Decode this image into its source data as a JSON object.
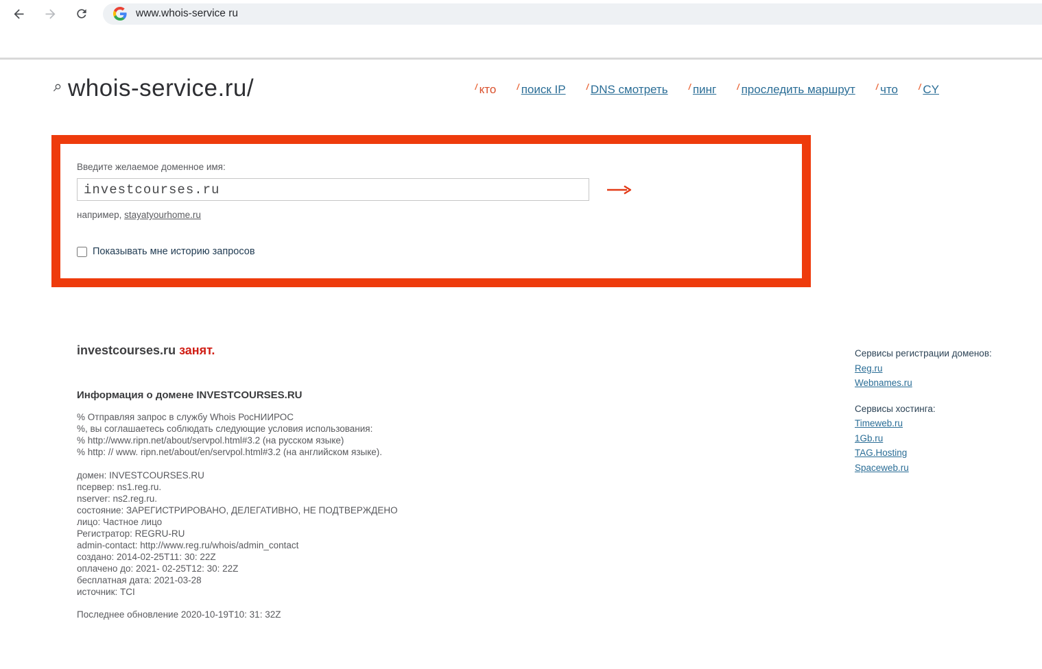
{
  "browser": {
    "url": "www.whois-service ru"
  },
  "header": {
    "title": "whois-service.ru/",
    "nav": [
      {
        "label": "кто",
        "active": true
      },
      {
        "label": "поиск IP",
        "active": false
      },
      {
        "label": "DNS смотреть",
        "active": false
      },
      {
        "label": "пинг",
        "active": false
      },
      {
        "label": "проследить маршрут",
        "active": false
      },
      {
        "label": "что",
        "active": false
      },
      {
        "label": "CY",
        "active": false
      }
    ]
  },
  "form": {
    "label": "Введите желаемое доменное имя:",
    "input_value": "investcourses.ru",
    "example_prefix": "например, ",
    "example_link": "stayatyourhome.ru",
    "checkbox_label": "Показывать мне историю запросов",
    "checkbox_checked": false
  },
  "result": {
    "domain": "investcourses.ru",
    "status": "занят.",
    "info_heading": "Информация о домене INVESTCOURSES.RU",
    "notice_lines": [
      "% Отправляя запрос в службу Whois РосНИИРОС",
      "%, вы соглашаетесь соблюдать следующие условия использования:",
      "% http://www.ripn.net/about/servpol.html#3.2 (на русском языке)",
      "% http: // www. ripn.net/about/en/servpol.html#3.2 (на английском языке)."
    ],
    "record_lines": [
      "домен: INVESTCOURSES.RU",
      "псервер: ns1.reg.ru.",
      "nserver: ns2.reg.ru.",
      "состояние: ЗАРЕГИСТРИРОВАНО, ДЕЛЕГАТИВНО, НЕ ПОДТВЕРЖДЕНО",
      "лицо: Частное лицо",
      "Регистратор: REGRU-RU",
      "admin-contact: http://www.reg.ru/whois/admin_contact",
      "создано: 2014-02-25T11: 30: 22Z",
      "оплачено до: 2021- 02-25T12: 30: 22Z",
      "бесплатная дата: 2021-03-28",
      "источник: TCI"
    ],
    "last_update": "Последнее обновление 2020-10-19T10: 31: 32Z"
  },
  "sidebar": {
    "registration_heading": "Сервисы регистрации доменов:",
    "registration_links": [
      "Reg.ru",
      "Webnames.ru"
    ],
    "hosting_heading": "Сервисы хостинга:",
    "hosting_links": [
      "Timeweb.ru",
      "1Gb.ru",
      "TAG.Hosting",
      "Spaceweb.ru"
    ]
  },
  "icons": {
    "back": "back-arrow",
    "forward": "forward-arrow",
    "reload": "reload-circular-arrow",
    "google_logo": "google-g",
    "magnifier": "magnifying-glass",
    "submit": "right-arrow"
  },
  "colors": {
    "accent_red_border": "#ee3b0c",
    "submit_arrow_red": "#e23a17",
    "link_blue": "#2a6d96",
    "nav_active_red": "#d94f2b",
    "status_red": "#d01f16",
    "body_gray": "#58595d",
    "dark_navy": "#1e3950"
  }
}
